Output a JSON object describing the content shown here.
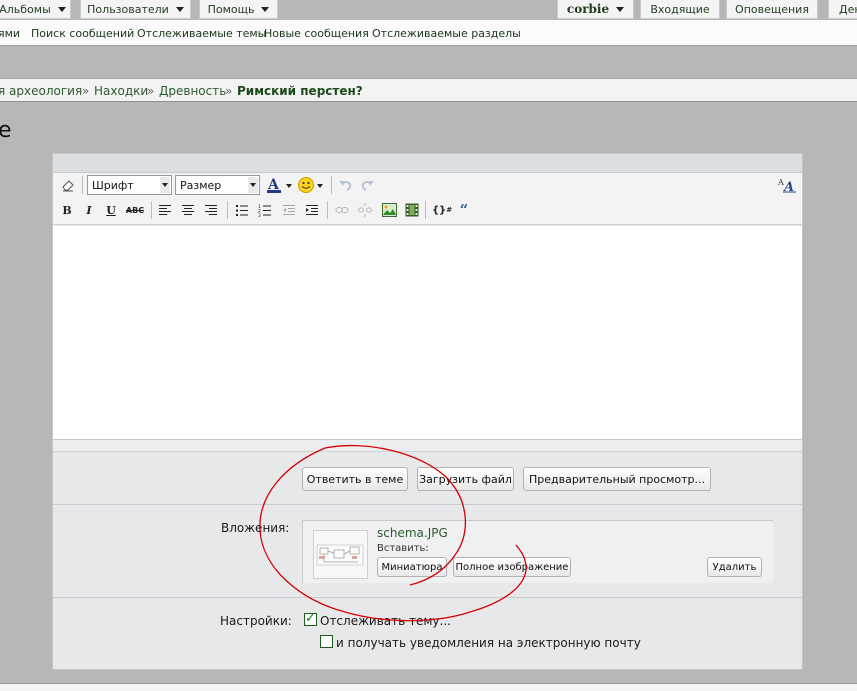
{
  "top_tabs": {
    "albums": "Альбомы",
    "users": "Пользователи",
    "help": "Помощь",
    "user": "corbie",
    "inbox": "Входящие",
    "alerts": "Оповещения",
    "partial_right": "Ден"
  },
  "sub_nav": {
    "partial_left": "ями",
    "search": "Поиск сообщений",
    "watched_threads": "Отслеживаемые темы",
    "new_posts": "Новые сообщения",
    "watched_forums": "Отслеживаемые разделы"
  },
  "breadcrumb": {
    "partial": "я археология",
    "sep": "»",
    "item2": "Находки",
    "item3": "Древность",
    "current": "Римский перстен?"
  },
  "page_heading_partial": "е",
  "toolbar": {
    "font_placeholder": "Шрифт",
    "size_placeholder": "Размер"
  },
  "buttons": {
    "reply": "Ответить в теме",
    "upload": "Загрузить файл",
    "preview": "Предварительный просмотр..."
  },
  "attachments": {
    "label": "Вложения:",
    "file_name": "schema.JPG",
    "insert_label": "Вставить:",
    "thumb_button": "Миниатюра",
    "full_button": "Полное изображение",
    "delete_button": "Удалить"
  },
  "settings": {
    "label": "Настройки:",
    "watch_thread": "Отслеживать тему...",
    "watch_checked": true,
    "email_notify": "и получать уведомления на электронную почту",
    "email_checked": false
  },
  "colors": {
    "annotation": "#d40000",
    "link_green": "#2d5a2d"
  }
}
